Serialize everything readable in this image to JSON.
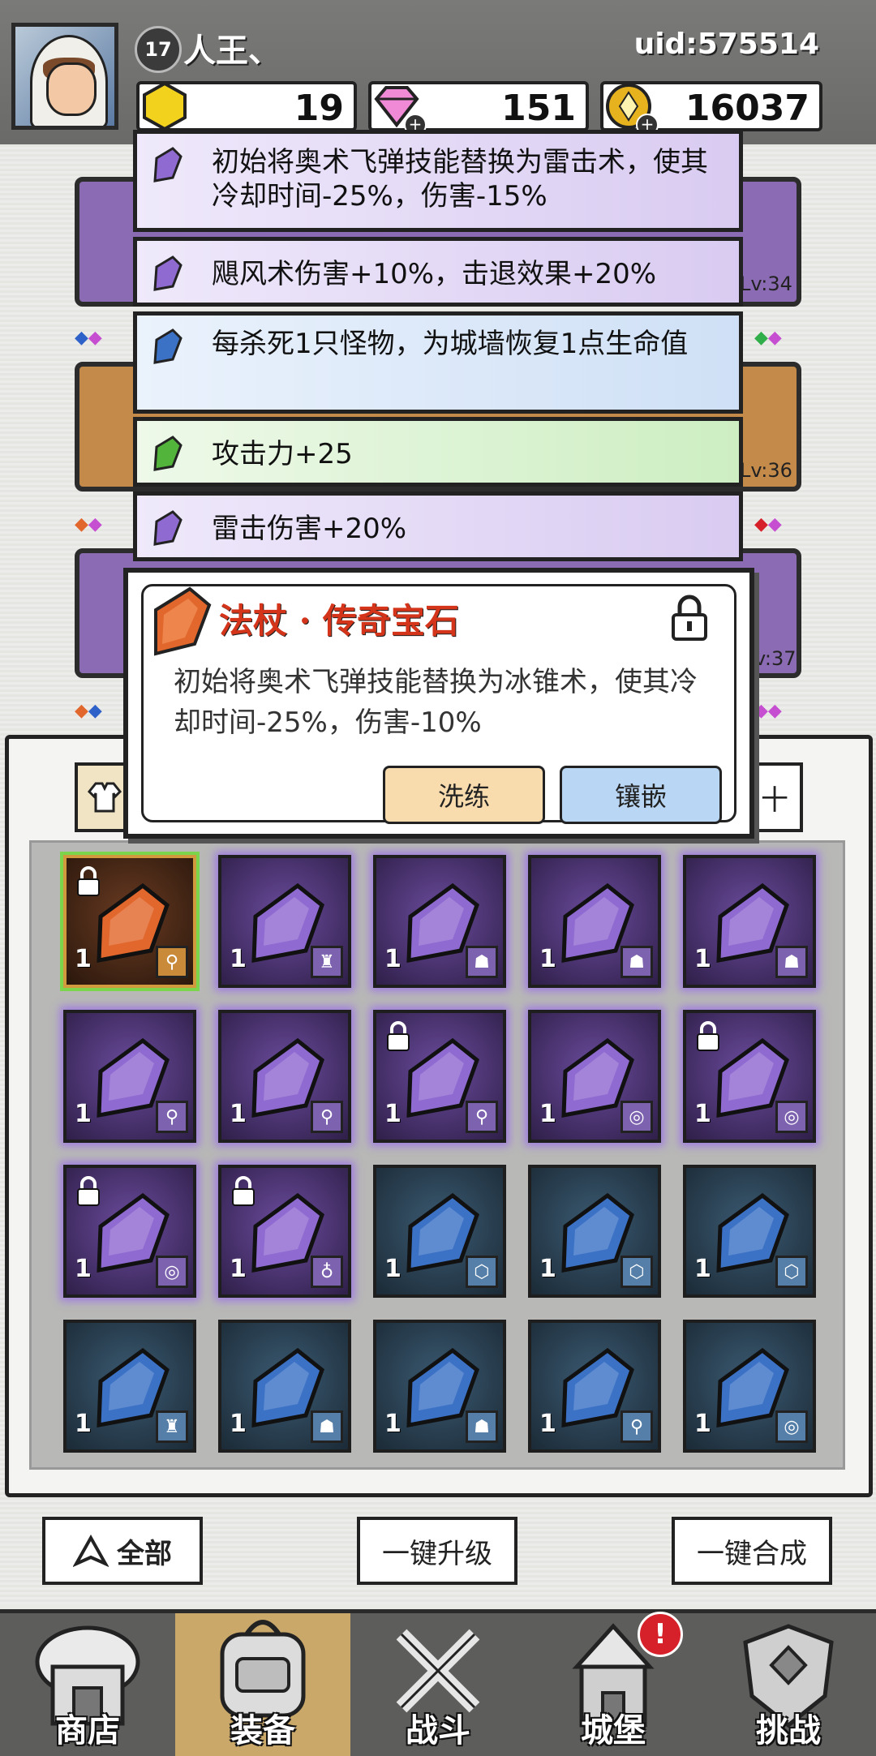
{
  "player": {
    "level": "17",
    "name": "人王、",
    "uid": "uid:575514"
  },
  "resources": {
    "gold_gems": "19",
    "diamonds": "151",
    "coins": "16037"
  },
  "tooltips": [
    {
      "gem": "purple",
      "text": "初始将奥术飞弹技能替换为雷击术，使其冷却时间-25%，伤害-15%"
    },
    {
      "gem": "purple",
      "text": "飓风术伤害+10%，击退效果+20%"
    },
    {
      "gem": "blue",
      "text": "每杀死1只怪物，为城墙恢复1点生命值"
    },
    {
      "gem": "green",
      "text": "攻击力+25"
    },
    {
      "gem": "purple",
      "text": "雷击伤害+20%"
    }
  ],
  "slot_levels": [
    "Lv:34",
    "Lv:36",
    "v:37"
  ],
  "dialog": {
    "title": "法杖 · 传奇宝石",
    "desc": "初始将奥术飞弹技能替换为冰锥术，使其冷却时间-25%，伤害-10%",
    "refine_label": "洗练",
    "inlay_label": "镶嵌"
  },
  "panel_edge_text": "十",
  "inventory": [
    {
      "color": "orange",
      "count": "1",
      "type": "staff-icon",
      "locked": true
    },
    {
      "color": "purple",
      "count": "1",
      "type": "armor-icon",
      "locked": false
    },
    {
      "color": "purple",
      "count": "1",
      "type": "boots-icon",
      "locked": false
    },
    {
      "color": "purple",
      "count": "1",
      "type": "boots-icon",
      "locked": false
    },
    {
      "color": "purple",
      "count": "1",
      "type": "boots-icon",
      "locked": false
    },
    {
      "color": "purple",
      "count": "1",
      "type": "staff-icon",
      "locked": false
    },
    {
      "color": "purple",
      "count": "1",
      "type": "staff-icon",
      "locked": false
    },
    {
      "color": "purple",
      "count": "1",
      "type": "staff-icon",
      "locked": true
    },
    {
      "color": "purple",
      "count": "1",
      "type": "ring-icon",
      "locked": false
    },
    {
      "color": "purple",
      "count": "1",
      "type": "ring-icon",
      "locked": true
    },
    {
      "color": "purple",
      "count": "1",
      "type": "ring-icon",
      "locked": true
    },
    {
      "color": "purple",
      "count": "1",
      "type": "necklace-icon",
      "locked": true
    },
    {
      "color": "blue",
      "count": "1",
      "type": "shield-icon",
      "locked": false
    },
    {
      "color": "blue",
      "count": "1",
      "type": "shield-icon",
      "locked": false
    },
    {
      "color": "blue",
      "count": "1",
      "type": "shield-icon",
      "locked": false
    },
    {
      "color": "blue",
      "count": "1",
      "type": "armor-icon",
      "locked": false
    },
    {
      "color": "blue",
      "count": "1",
      "type": "boots-icon",
      "locked": false
    },
    {
      "color": "blue",
      "count": "1",
      "type": "boots-icon",
      "locked": false
    },
    {
      "color": "blue",
      "count": "1",
      "type": "staff-icon",
      "locked": false
    },
    {
      "color": "blue",
      "count": "1",
      "type": "ring-icon",
      "locked": false
    }
  ],
  "actions": {
    "filter_label": "全部",
    "upgrade_all_label": "一键升级",
    "merge_all_label": "一键合成"
  },
  "nav": [
    {
      "label": "商店",
      "icon": "shop-icon"
    },
    {
      "label": "装备",
      "icon": "backpack-icon"
    },
    {
      "label": "战斗",
      "icon": "swords-icon"
    },
    {
      "label": "城堡",
      "icon": "castle-icon"
    },
    {
      "label": "挑战",
      "icon": "shield-challenge-icon"
    }
  ],
  "castle_badge": "!",
  "colors": {
    "purple": "#8f6ad1",
    "blue": "#3c72c6",
    "orange": "#e2672c",
    "green": "#52b43a"
  }
}
